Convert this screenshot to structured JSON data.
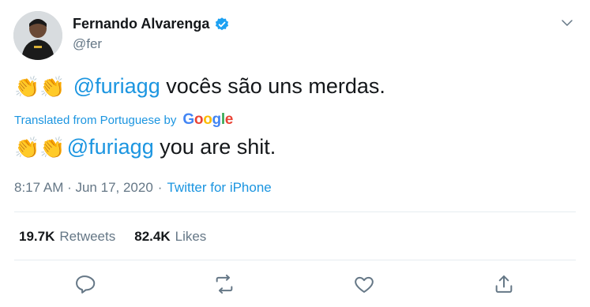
{
  "author": {
    "name": "Fernando Alvarenga",
    "handle": "@fer",
    "verified": true
  },
  "tweet": {
    "emoji": "👏👏",
    "original": {
      "mention": "@furiagg",
      "text": " vocês são uns merdas."
    },
    "translation_label": "Translated from Portuguese by",
    "translation_provider": "Google",
    "translated": {
      "mention": "@furiagg",
      "text": " you are shit."
    },
    "timestamp": "8:17 AM · Jun 17, 2020",
    "separator": "·",
    "source": "Twitter for iPhone"
  },
  "stats": {
    "retweets_count": "19.7K",
    "retweets_label": "Retweets",
    "likes_count": "82.4K",
    "likes_label": "Likes"
  },
  "colors": {
    "accent": "#1b95e0",
    "muted": "#657786",
    "text": "#14171a",
    "divider": "#e6ecf0"
  },
  "icons": {
    "caret": "chevron-down-icon",
    "verified": "verified-badge-icon",
    "reply": "reply-icon",
    "retweet": "retweet-icon",
    "like": "heart-icon",
    "share": "share-icon"
  }
}
